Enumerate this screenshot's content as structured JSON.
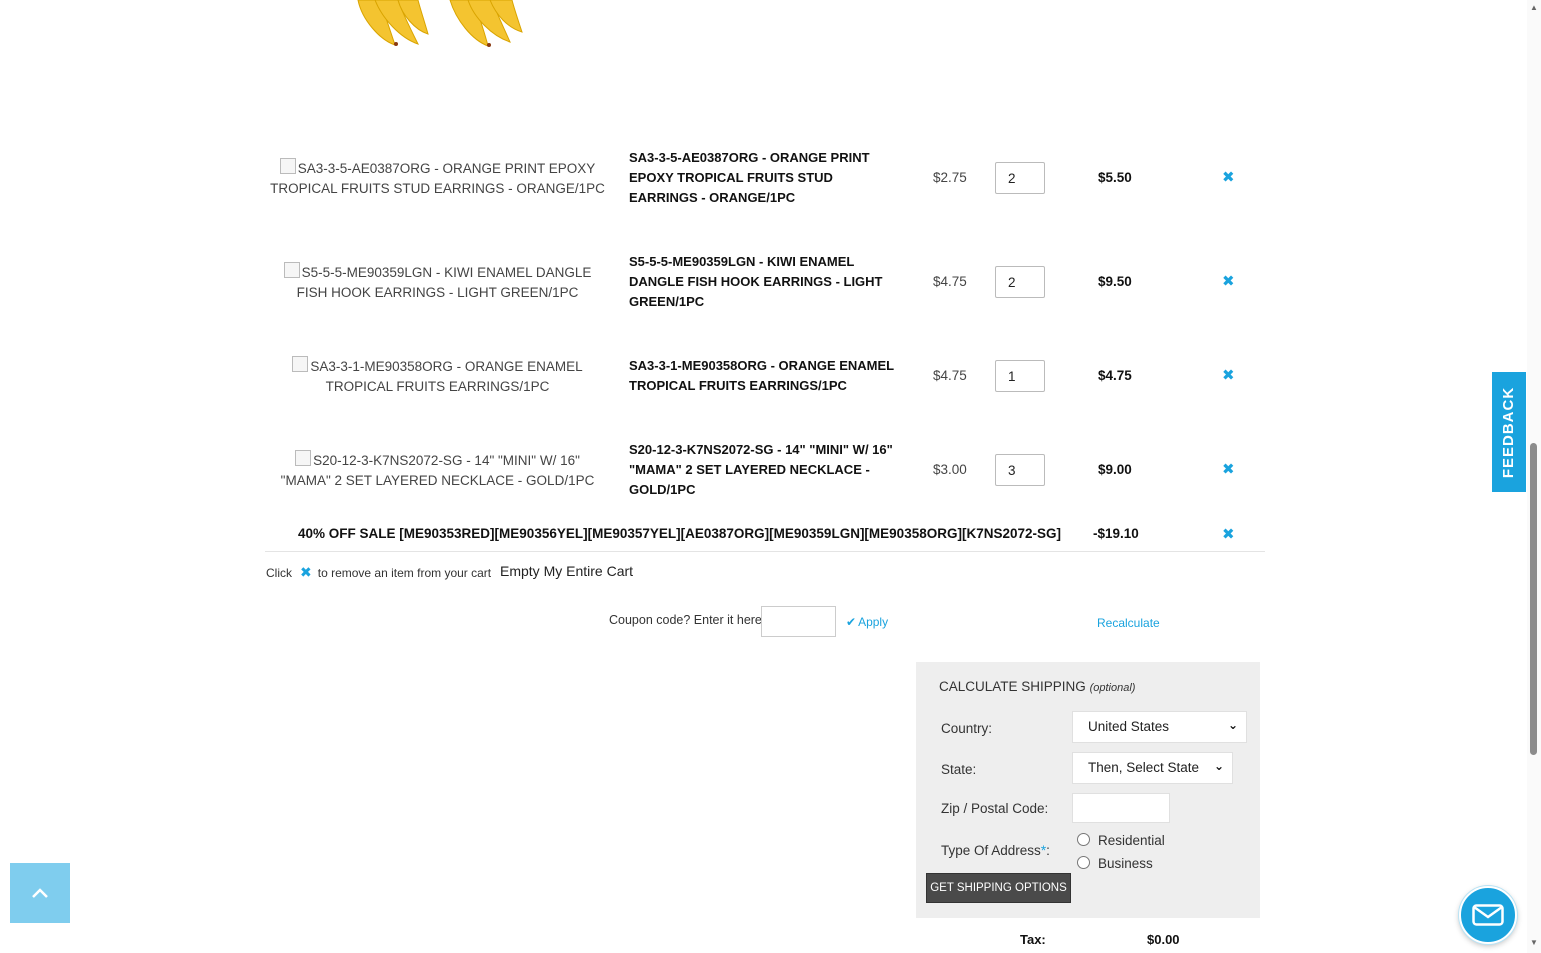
{
  "cart": {
    "items": [
      {
        "image_alt": "SA3-3-5-AE0387ORG - ORANGE PRINT EPOXY TROPICAL FRUITS STUD EARRINGS - ORANGE/1PC",
        "name": "SA3-3-5-AE0387ORG - ORANGE PRINT EPOXY TROPICAL FRUITS STUD EARRINGS - ORANGE/1PC",
        "unit_price": "$2.75",
        "quantity": "2",
        "total": "$5.50"
      },
      {
        "image_alt": "S5-5-5-ME90359LGN - KIWI ENAMEL DANGLE FISH HOOK EARRINGS - LIGHT GREEN/1PC",
        "name": "S5-5-5-ME90359LGN - KIWI ENAMEL DANGLE FISH HOOK EARRINGS - LIGHT GREEN/1PC",
        "unit_price": "$4.75",
        "quantity": "2",
        "total": "$9.50"
      },
      {
        "image_alt": "SA3-3-1-ME90358ORG - ORANGE ENAMEL TROPICAL FRUITS EARRINGS/1PC",
        "name": "SA3-3-1-ME90358ORG - ORANGE ENAMEL TROPICAL FRUITS EARRINGS/1PC",
        "unit_price": "$4.75",
        "quantity": "1",
        "total": "$4.75"
      },
      {
        "image_alt": "S20-12-3-K7NS2072-SG - 14\" \"MINI\" W/ 16\" \"MAMA\" 2 SET LAYERED NECKLACE - GOLD/1PC",
        "name": "S20-12-3-K7NS2072-SG - 14\" \"MINI\" W/ 16\" \"MAMA\" 2 SET LAYERED NECKLACE - GOLD/1PC",
        "unit_price": "$3.00",
        "quantity": "3",
        "total": "$9.00"
      }
    ],
    "discount": {
      "label": "40% OFF SALE [ME90353RED][ME90356YEL][ME90357YEL][AE0387ORG][ME90359LGN][ME90358ORG][K7NS2072-SG]",
      "amount": "-$19.10"
    },
    "remove_hint_before": "Click",
    "remove_hint_after": "to remove an item from your cart",
    "empty_cart_label": "Empty My Entire Cart",
    "coupon_label": "Coupon code? Enter it here:",
    "apply_label": "Apply",
    "recalculate_label": "Recalculate"
  },
  "shipping": {
    "title": "CALCULATE SHIPPING",
    "title_note": "(optional)",
    "country_label": "Country:",
    "country_value": "United States",
    "state_label": "State:",
    "state_value": "Then, Select State",
    "zip_label": "Zip / Postal Code:",
    "address_type_label": "Type Of Address",
    "required_mark": "*",
    "address_type_suffix": ":",
    "residential_label": "Residential",
    "business_label": "Business",
    "button_label": "GET SHIPPING OPTIONS"
  },
  "tax": {
    "label": "Tax:",
    "value": "$0.00"
  },
  "feedback_label": "FEEDBACK",
  "colors": {
    "accent": "#1aa3de",
    "back_to_top": "#7fcdee",
    "shipping_box": "#eeeeee",
    "button": "#4a4a4a"
  }
}
